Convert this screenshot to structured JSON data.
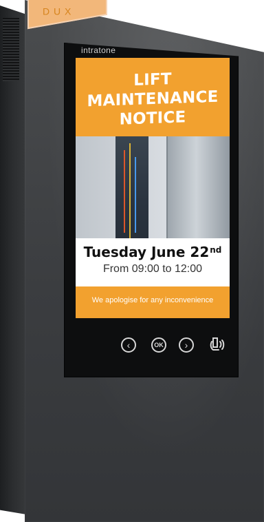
{
  "device": {
    "brand": "intratone",
    "label_tab_text": "D U X"
  },
  "notice": {
    "title_lines": [
      "LIFT",
      "MAINTENANCE",
      "NOTICE"
    ],
    "date_main": "Tuesday June 22",
    "date_suffix": "nd",
    "time": "From 09:00 to 12:00",
    "footer": "We apologise for any inconvenience"
  },
  "controls": {
    "left_symbol": "‹",
    "ok_label": "OK",
    "right_symbol": "›"
  },
  "colors": {
    "accent_orange": "#f2a12f",
    "device_body": "#3b3d40",
    "screen_bezel": "#0d0e0f"
  }
}
